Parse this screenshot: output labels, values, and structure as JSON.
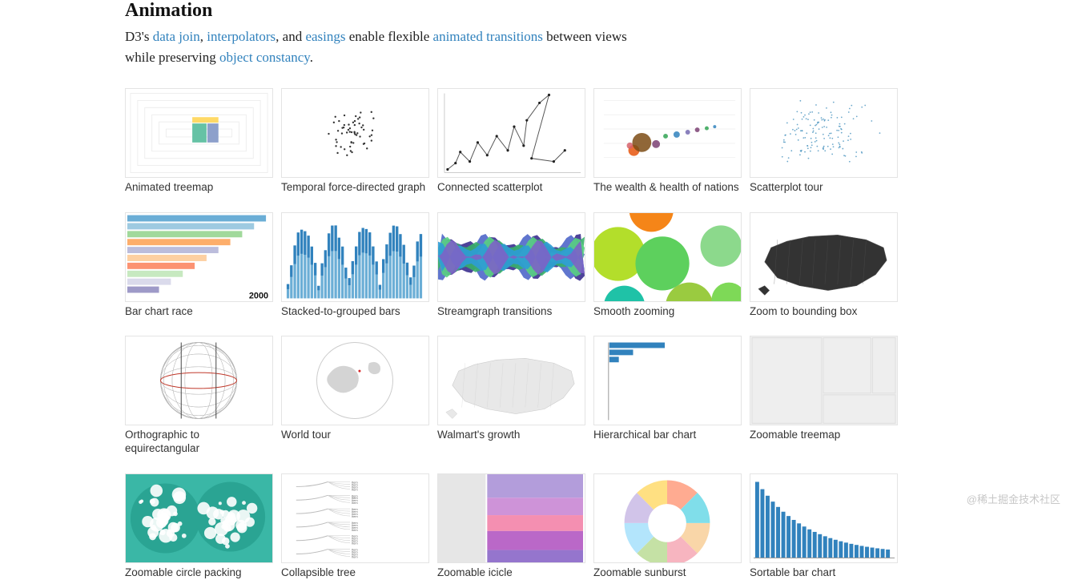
{
  "section": {
    "title": "Animation",
    "intro_parts": {
      "prefix": "D3's ",
      "link1": "data join",
      "sep1": ", ",
      "link2": "interpolators",
      "sep2": ", and ",
      "link3": "easings",
      "mid": " enable flexible ",
      "link4": "animated transitions",
      "mid2": " between views while preserving ",
      "link5": "object constancy",
      "suffix": "."
    }
  },
  "gallery": [
    {
      "label": "Animated treemap",
      "kind": "treemap-anim"
    },
    {
      "label": "Temporal force-directed graph",
      "kind": "force"
    },
    {
      "label": "Connected scatterplot",
      "kind": "connected-scatter"
    },
    {
      "label": "The wealth & health of nations",
      "kind": "bubbles-color"
    },
    {
      "label": "Scatterplot tour",
      "kind": "scatter"
    },
    {
      "label": "Bar chart race",
      "kind": "bar-race"
    },
    {
      "label": "Stacked-to-grouped bars",
      "kind": "stacked-bars"
    },
    {
      "label": "Streamgraph transitions",
      "kind": "streamgraph"
    },
    {
      "label": "Smooth zooming",
      "kind": "big-dots"
    },
    {
      "label": "Zoom to bounding box",
      "kind": "us-dark"
    },
    {
      "label": "Orthographic to equirectangular",
      "kind": "globe-wire"
    },
    {
      "label": "World tour",
      "kind": "globe-land"
    },
    {
      "label": "Walmart's growth",
      "kind": "us-light"
    },
    {
      "label": "Hierarchical bar chart",
      "kind": "hbar-single"
    },
    {
      "label": "Zoomable treemap",
      "kind": "treemap-flat"
    },
    {
      "label": "Zoomable circle packing",
      "kind": "circle-pack"
    },
    {
      "label": "Collapsible tree",
      "kind": "tree"
    },
    {
      "label": "Zoomable icicle",
      "kind": "icicle"
    },
    {
      "label": "Zoomable sunburst",
      "kind": "sunburst"
    },
    {
      "label": "Sortable bar chart",
      "kind": "sorted-bars"
    }
  ],
  "watermark": "@稀土掘金技术社区"
}
